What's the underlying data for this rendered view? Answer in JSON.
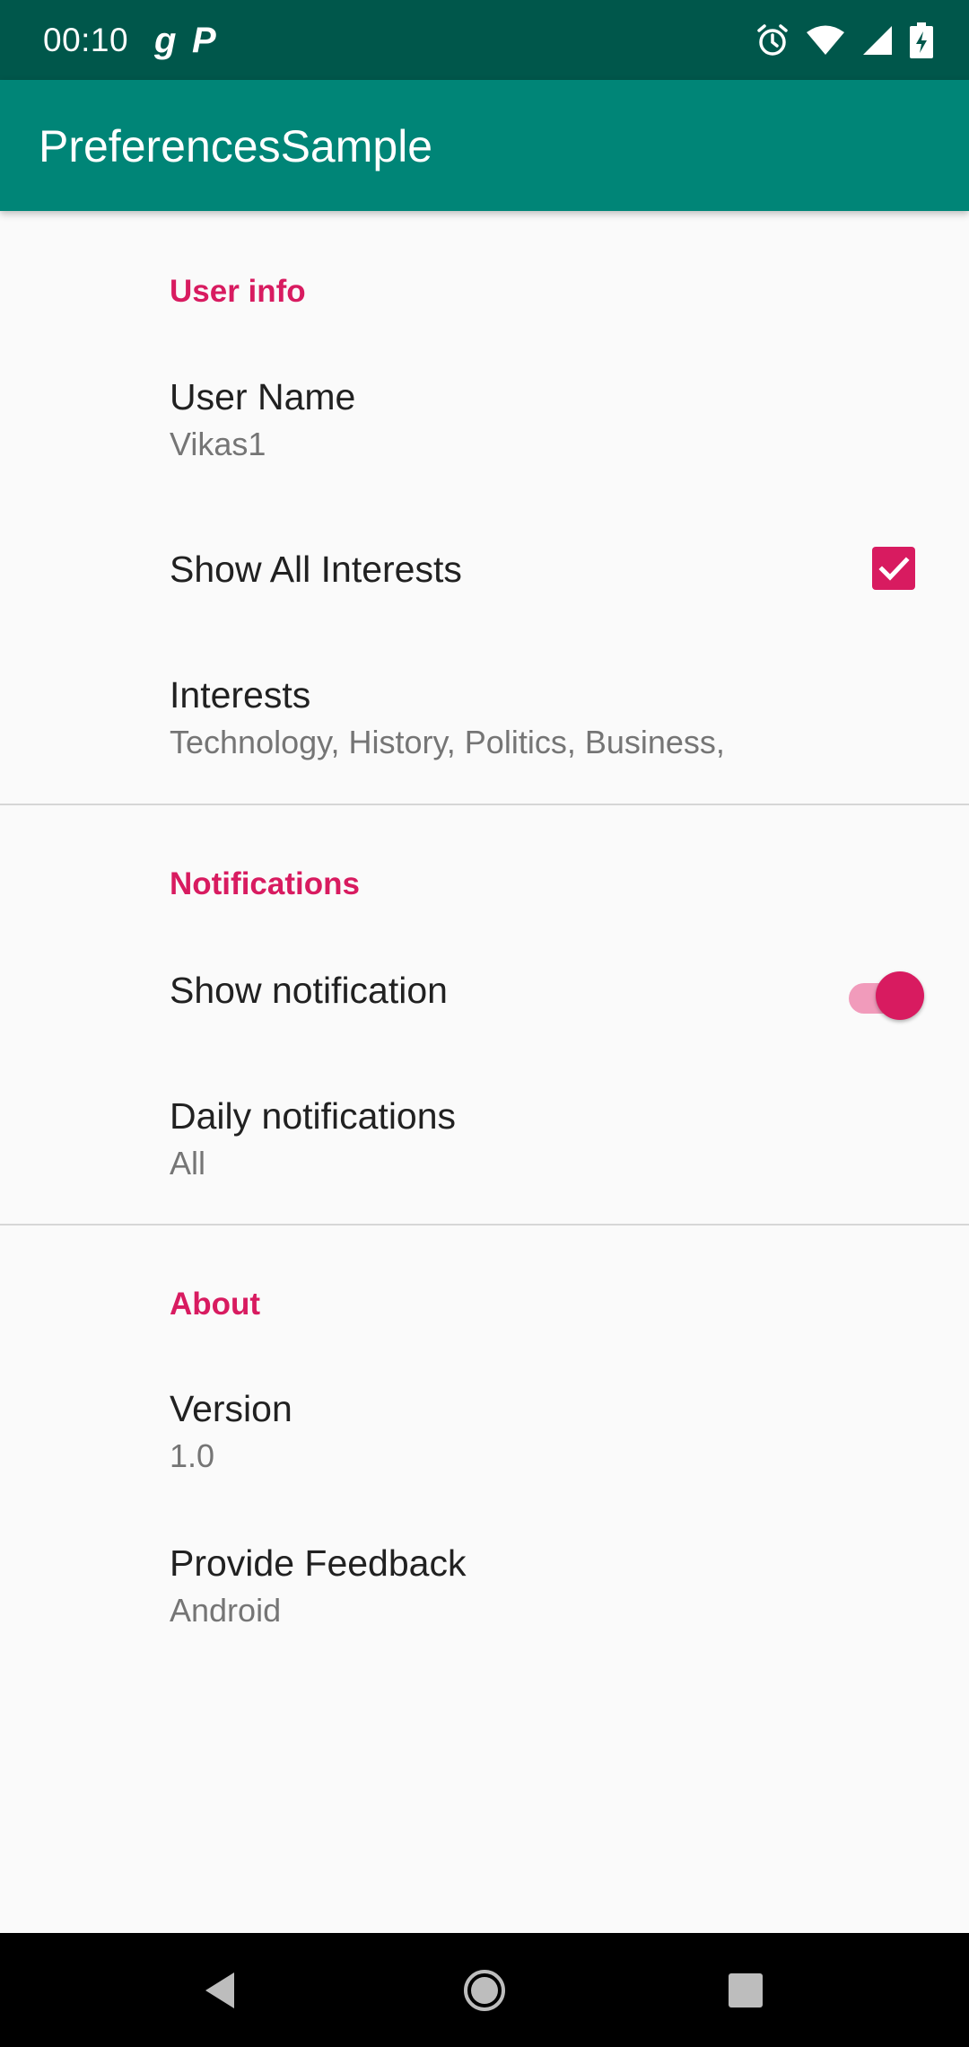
{
  "status_bar": {
    "time": "00:10",
    "app_icons": [
      "g",
      "P"
    ],
    "right_icons": [
      "alarm-icon",
      "wifi-icon",
      "signal-icon",
      "battery-icon"
    ]
  },
  "app_bar": {
    "title": "PreferencesSample"
  },
  "sections": [
    {
      "category": "User info",
      "prefs": [
        {
          "title": "User Name",
          "summary": "Vikas1"
        },
        {
          "title": "Show All Interests",
          "checked": true
        },
        {
          "title": "Interests",
          "summary": "Technology, History, Politics, Business,"
        }
      ]
    },
    {
      "category": "Notifications",
      "prefs": [
        {
          "title": "Show notification",
          "switch_on": true
        },
        {
          "title": "Daily notifications",
          "summary": "All"
        }
      ]
    },
    {
      "category": "About",
      "prefs": [
        {
          "title": "Version",
          "summary": "1.0"
        },
        {
          "title": "Provide Feedback",
          "summary": "Android"
        }
      ]
    }
  ],
  "colors": {
    "status_bar": "#00574b",
    "app_bar": "#008577",
    "accent": "#d81b60",
    "background": "#fafafa"
  },
  "nav_bar": [
    "back-icon",
    "home-icon",
    "recents-icon"
  ]
}
